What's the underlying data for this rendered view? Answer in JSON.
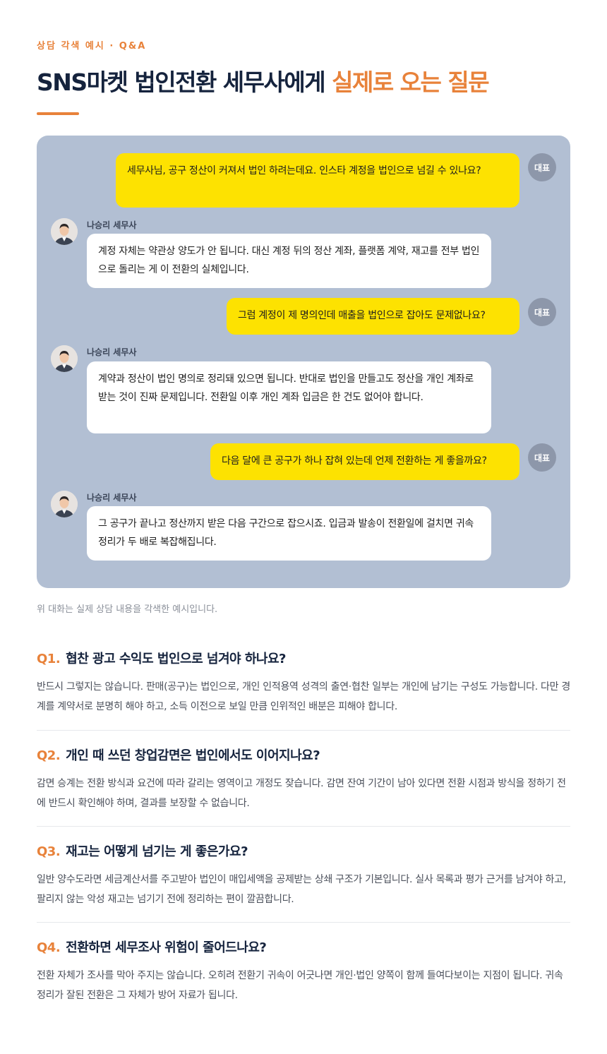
{
  "header": {
    "eyebrow": "상담 각색 예시 · Q&A",
    "title_main": "SNS마켓 법인전환 세무사에게 ",
    "title_highlight": "실제로 오는 질문"
  },
  "chat": {
    "me_label": "대표",
    "advisor_name": "나승리 세무사",
    "messages": [
      {
        "from": "me",
        "text": "세무사님, 공구 정산이 커져서 법인 하려는데요. 인스타 계정을 법인으로 넘길 수 있나요?"
      },
      {
        "from": "advisor",
        "text": "계정 자체는 약관상 양도가 안 됩니다. 대신 계정 뒤의 정산 계좌, 플랫폼 계약, 재고를 전부 법인으로 돌리는 게 이 전환의 실체입니다."
      },
      {
        "from": "me",
        "text": "그럼 계정이 제 명의인데 매출을 법인으로 잡아도 문제없나요?"
      },
      {
        "from": "advisor",
        "text": "계약과 정산이 법인 명의로 정리돼 있으면 됩니다. 반대로 법인을 만들고도 정산을 개인 계좌로 받는 것이 진짜 문제입니다. 전환일 이후 개인 계좌 입금은 한 건도 없어야 합니다."
      },
      {
        "from": "me",
        "text": "다음 달에 큰 공구가 하나 잡혀 있는데 언제 전환하는 게 좋을까요?"
      },
      {
        "from": "advisor",
        "text": "그 공구가 끝나고 정산까지 받은 다음 구간으로 잡으시죠. 입금과 발송이 전환일에 걸치면 귀속 정리가 두 배로 복잡해집니다."
      }
    ]
  },
  "note": "위 대화는 실제 상담 내용을 각색한 예시입니다.",
  "faq": [
    {
      "num": "Q1.",
      "question": "협찬 광고 수익도 법인으로 넘겨야 하나요?",
      "answer": "반드시 그렇지는 않습니다. 판매(공구)는 법인으로, 개인 인적용역 성격의 출연·협찬 일부는 개인에 남기는 구성도 가능합니다. 다만 경계를 계약서로 분명히 해야 하고, 소득 이전으로 보일 만큼 인위적인 배분은 피해야 합니다."
    },
    {
      "num": "Q2.",
      "question": "개인 때 쓰던 창업감면은 법인에서도 이어지나요?",
      "answer": "감면 승계는 전환 방식과 요건에 따라 갈리는 영역이고 개정도 잦습니다. 감면 잔여 기간이 남아 있다면 전환 시점과 방식을 정하기 전에 반드시 확인해야 하며, 결과를 보장할 수 없습니다."
    },
    {
      "num": "Q3.",
      "question": "재고는 어떻게 넘기는 게 좋은가요?",
      "answer": "일반 양수도라면 세금계산서를 주고받아 법인이 매입세액을 공제받는 상쇄 구조가 기본입니다. 실사 목록과 평가 근거를 남겨야 하고, 팔리지 않는 악성 재고는 넘기기 전에 정리하는 편이 깔끔합니다."
    },
    {
      "num": "Q4.",
      "question": "전환하면 세무조사 위험이 줄어드나요?",
      "answer": "전환 자체가 조사를 막아 주지는 않습니다. 오히려 전환기 귀속이 어긋나면 개인·법인 양쪽이 함께 들여다보이는 지점이 됩니다. 귀속 정리가 잘된 전환은 그 자체가 방어 자료가 됩니다."
    }
  ]
}
